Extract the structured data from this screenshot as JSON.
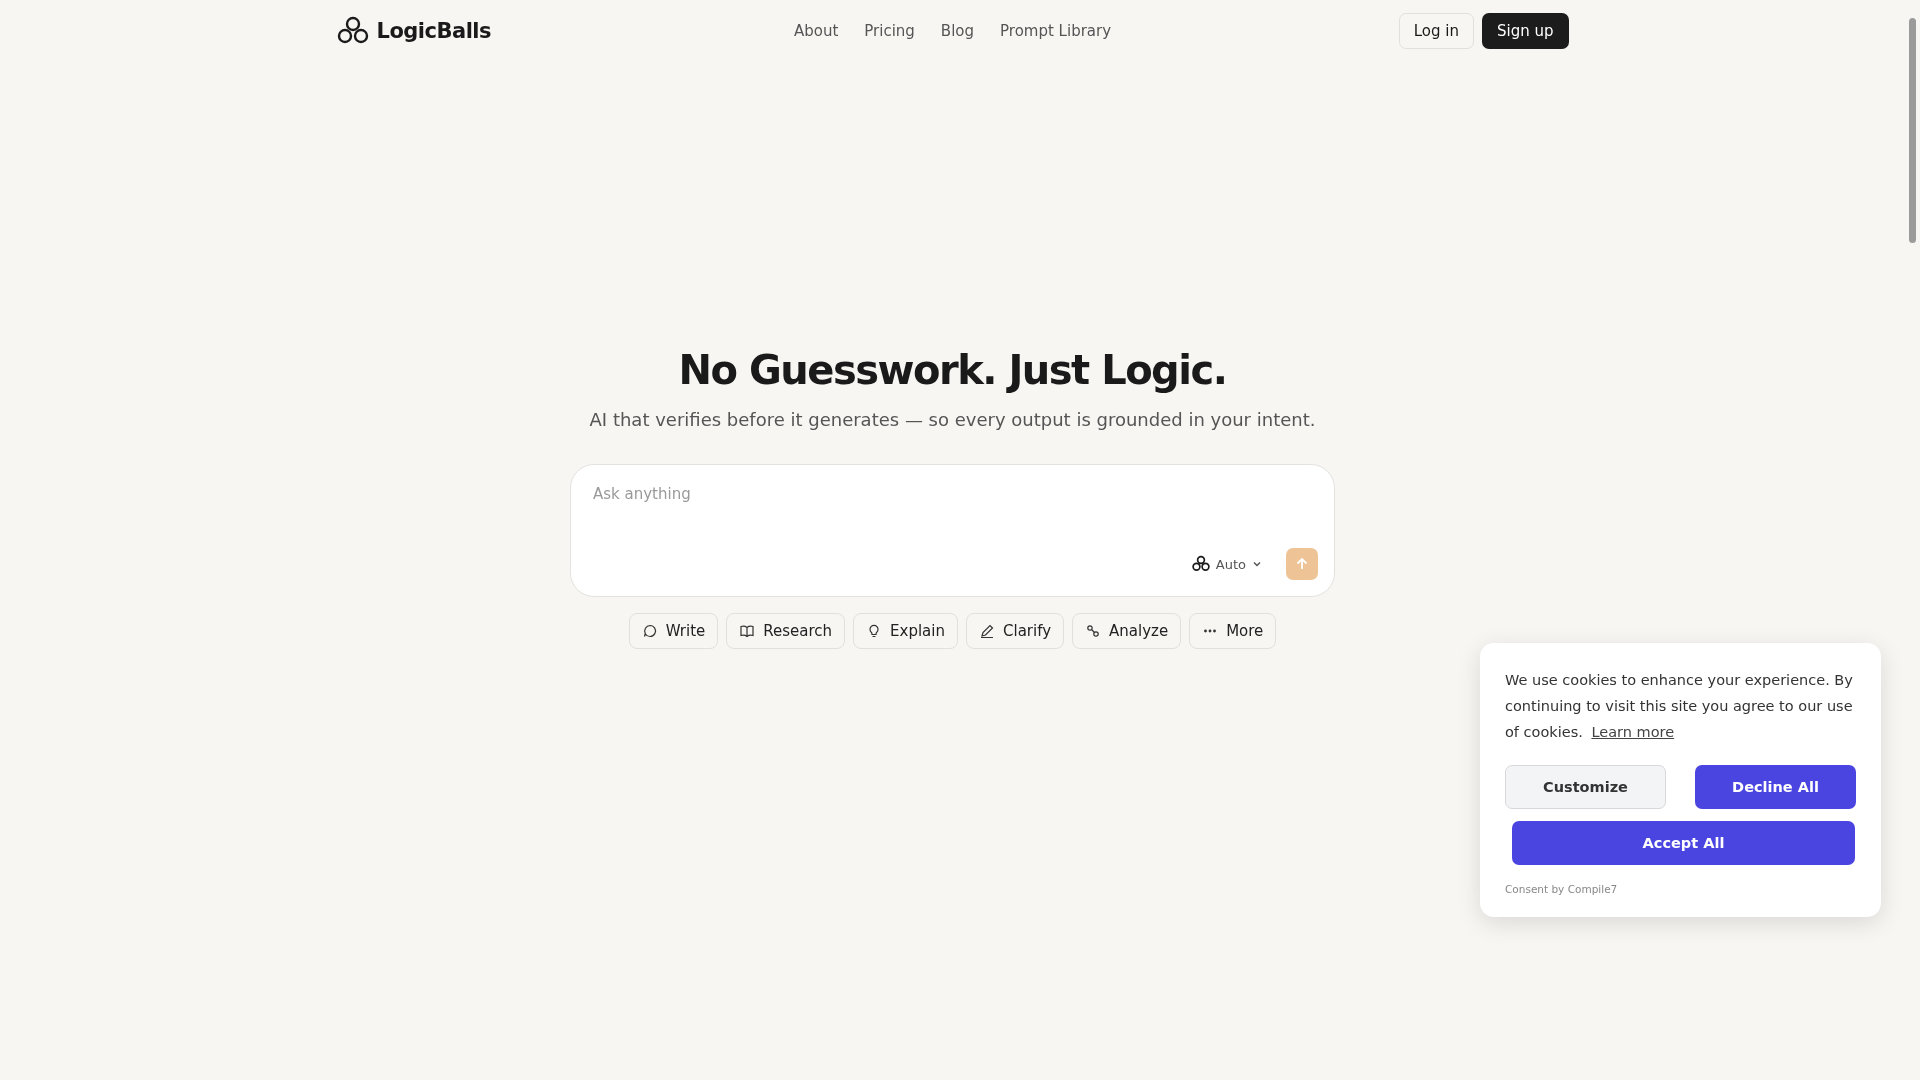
{
  "header": {
    "logo": "LogicBalls",
    "nav": [
      "About",
      "Pricing",
      "Blog",
      "Prompt Library"
    ],
    "login": "Log in",
    "signup": "Sign up"
  },
  "hero": {
    "title": "No Guesswork. Just Logic.",
    "subtitle": "AI that verifies before it generates — so every output is grounded in your intent."
  },
  "prompt": {
    "placeholder": "Ask anything",
    "model": "Auto",
    "send_disabled": true
  },
  "chips": [
    "Write",
    "Research",
    "Explain",
    "Clarify",
    "Analyze",
    "More"
  ],
  "cookie": {
    "text": "We use cookies to enhance your experience. By continuing to visit this site you agree to our use of cookies.",
    "link": "Learn more",
    "customize": "Customize",
    "decline": "Decline All",
    "accept": "Accept All",
    "credit": "Consent by Compile7"
  }
}
